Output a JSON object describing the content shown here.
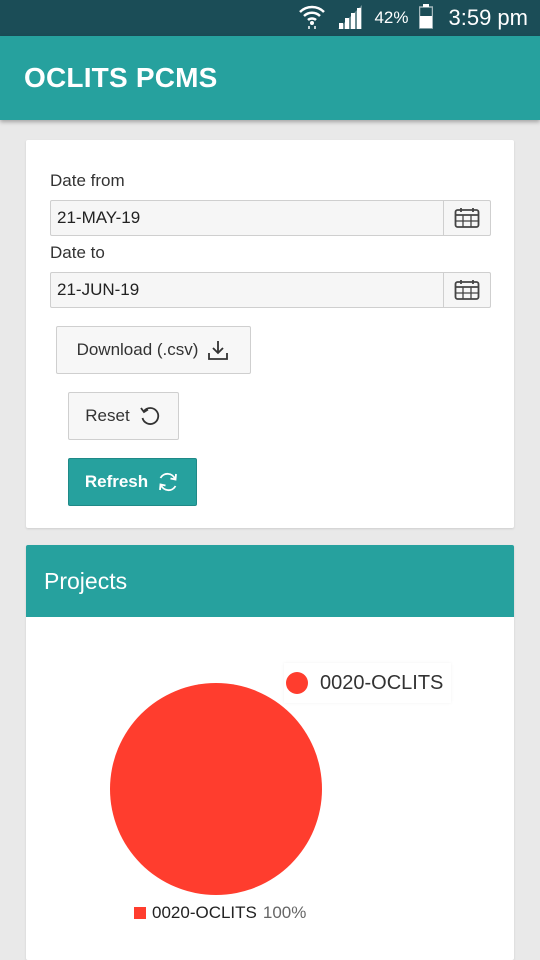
{
  "status_bar": {
    "battery_percent": "42%",
    "time": "3:59 pm",
    "icons": [
      "wifi-icon",
      "signal-icon",
      "battery-icon"
    ]
  },
  "app_bar": {
    "title": "OCLITS PCMS"
  },
  "filters": {
    "date_from_label": "Date from",
    "date_from_value": "21-MAY-19",
    "date_to_label": "Date to",
    "date_to_value": "21-JUN-19",
    "download_label": "Download (.csv)",
    "reset_label": "Reset",
    "refresh_label": "Refresh"
  },
  "projects": {
    "title": "Projects",
    "legend_top_label": "0020-OCLITS",
    "legend_bottom_label": "0020-OCLITS",
    "legend_bottom_percent": "100%"
  },
  "colors": {
    "primary": "#26a19e",
    "status_bar": "#1b4d57",
    "pie_red": "#ff3d2e"
  },
  "chart_data": {
    "type": "pie",
    "categories": [
      "0020-OCLITS"
    ],
    "values": [
      100
    ],
    "colors": [
      "#ff3d2e"
    ],
    "legend": "top-right"
  }
}
